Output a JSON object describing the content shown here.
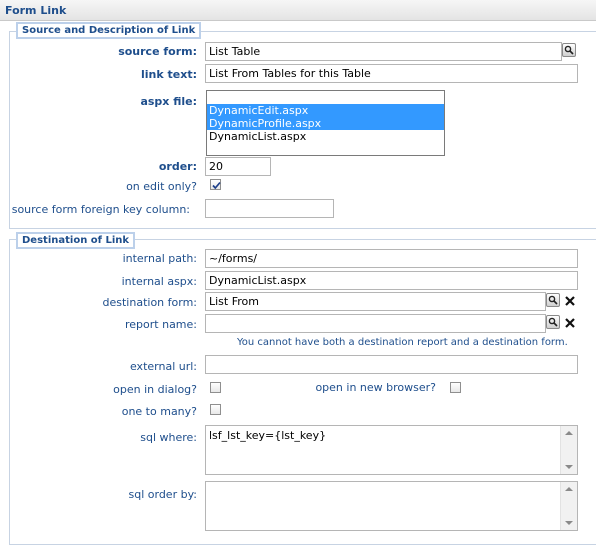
{
  "header": {
    "title": "Form Link"
  },
  "source_section": {
    "legend": "Source and Description of Link",
    "source_form": {
      "label": "source form:",
      "value": "List Table"
    },
    "link_text": {
      "label": "link text:",
      "value": "List From Tables for this Table"
    },
    "aspx_file": {
      "label": "aspx file:",
      "options": [
        {
          "text": "DynamicEdit.aspx",
          "selected": true
        },
        {
          "text": "DynamicProfile.aspx",
          "selected": true
        },
        {
          "text": "DynamicList.aspx",
          "selected": false
        }
      ]
    },
    "order": {
      "label": "order:",
      "value": "20"
    },
    "on_edit_only": {
      "label": "on edit only?",
      "checked": true
    },
    "source_fk": {
      "label": "source form foreign key column:",
      "value": ""
    }
  },
  "destination_section": {
    "legend": "Destination of Link",
    "internal_path": {
      "label": "internal path:",
      "value": "~/forms/"
    },
    "internal_aspx": {
      "label": "internal aspx:",
      "value": "DynamicList.aspx"
    },
    "destination_form": {
      "label": "destination form:",
      "value": "List From"
    },
    "report_name": {
      "label": "report name:",
      "value": ""
    },
    "warning": "You cannot have both a destination report and a destination form.",
    "external_url": {
      "label": "external url:",
      "value": ""
    },
    "open_in_dialog": {
      "label": "open in dialog?",
      "checked": false
    },
    "open_new_browser": {
      "label": "open in new browser?",
      "checked": false
    },
    "one_to_many": {
      "label": "one to many?",
      "checked": false
    },
    "sql_where": {
      "label": "sql where:",
      "value": "lsf_lst_key={lst_key}"
    },
    "sql_order_by": {
      "label": "sql order by:",
      "value": ""
    }
  },
  "colors": {
    "label": "#1e4e8c",
    "selection": "#3399ff",
    "border": "#c7d3e3"
  },
  "icons": {
    "lookup": "magnifier-icon",
    "clear": "close-icon",
    "check": "checkmark-icon"
  }
}
